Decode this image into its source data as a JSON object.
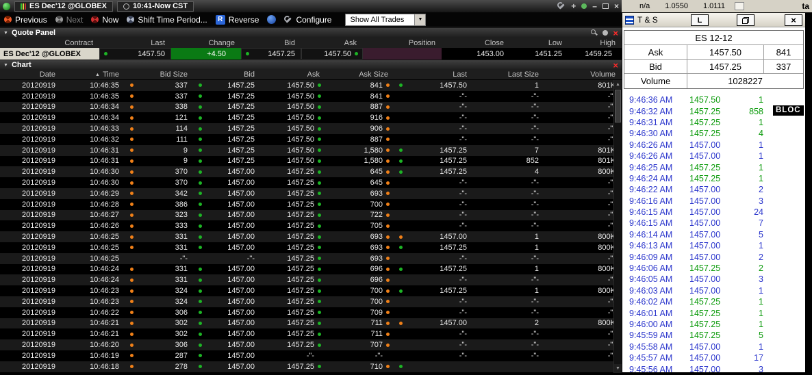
{
  "icons": {
    "close": "×",
    "minimize": "–",
    "collapse": "▼",
    "sort_asc": "▲",
    "up_arrow": "▲",
    "down_arrow": "▼",
    "dropdown_arrow": "▼"
  },
  "colors": {
    "dot_green": "#1db425",
    "dot_orange": "#f08018",
    "change_bg": "#0a7a14",
    "ask_green": "#0a9a0a",
    "bid_blue": "#2a35cc",
    "contract_bg": "#d9d6ca",
    "position_bg": "#3a1c2e"
  },
  "top_fragment": {
    "values": [
      "n/a",
      "1.0550",
      "1.0111"
    ],
    "tab_text": "ta"
  },
  "left_window": {
    "title": {
      "symbol": "ES Dec'12 @GLOBEX",
      "range": "10:41-Now CST"
    },
    "toolbar": {
      "previous": "Previous",
      "next": "Next",
      "now": "Now",
      "shift_time": "Shift Time Period...",
      "reverse_letter": "R",
      "reverse": "Reverse",
      "configure": "Configure",
      "trades_filter": "Show All Trades"
    },
    "quote_panel": {
      "title": "Quote Panel",
      "columns": [
        "Contract",
        "Last",
        "Change",
        "Bid",
        "Ask",
        "Position",
        "Close",
        "Low",
        "High"
      ],
      "row": {
        "contract": "ES Dec'12 @GLOBEX",
        "last": "1457.50",
        "change": "+4.50",
        "bid": "1457.25",
        "ask": "1457.50",
        "position": "",
        "close": "1453.00",
        "low": "1451.25",
        "high": "1459.25"
      }
    },
    "chart": {
      "title": "Chart",
      "columns": [
        "Date",
        "Time",
        "Bid Size",
        "Bid",
        "Ask",
        "Ask Size",
        "Last",
        "Last Size",
        "Volume"
      ],
      "rows": [
        {
          "date": "20120919",
          "time": "10:46:35",
          "bid_size": "337",
          "bs_dot": "orange",
          "bid": "1457.25",
          "bid_dot": "green",
          "ask": "1457.50",
          "ask_dot": "green",
          "ask_size": "841",
          "as_dot": "orange",
          "last": "1457.50",
          "last_dot": "green",
          "last_size": "1",
          "volume": "801K"
        },
        {
          "date": "20120919",
          "time": "10:46:35",
          "bid_size": "337",
          "bs_dot": "orange",
          "bid": "1457.25",
          "bid_dot": "green",
          "ask": "1457.50",
          "ask_dot": "green",
          "ask_size": "841",
          "as_dot": "orange",
          "last": "-\"-",
          "last_size": "-\"-",
          "volume": "-\"-"
        },
        {
          "date": "20120919",
          "time": "10:46:34",
          "bid_size": "338",
          "bs_dot": "orange",
          "bid": "1457.25",
          "bid_dot": "green",
          "ask": "1457.50",
          "ask_dot": "green",
          "ask_size": "887",
          "as_dot": "orange",
          "last": "-\"-",
          "last_size": "-\"-",
          "volume": "-\"-"
        },
        {
          "date": "20120919",
          "time": "10:46:34",
          "bid_size": "121",
          "bs_dot": "orange",
          "bid": "1457.25",
          "bid_dot": "green",
          "ask": "1457.50",
          "ask_dot": "green",
          "ask_size": "916",
          "as_dot": "orange",
          "last": "-\"-",
          "last_size": "-\"-",
          "volume": "-\"-"
        },
        {
          "date": "20120919",
          "time": "10:46:33",
          "bid_size": "114",
          "bs_dot": "orange",
          "bid": "1457.25",
          "bid_dot": "green",
          "ask": "1457.50",
          "ask_dot": "green",
          "ask_size": "906",
          "as_dot": "orange",
          "last": "-\"-",
          "last_size": "-\"-",
          "volume": "-\"-"
        },
        {
          "date": "20120919",
          "time": "10:46:32",
          "bid_size": "111",
          "bs_dot": "orange",
          "bid": "1457.25",
          "bid_dot": "green",
          "ask": "1457.50",
          "ask_dot": "green",
          "ask_size": "887",
          "as_dot": "orange",
          "last": "-\"-",
          "last_size": "-\"-",
          "volume": "-\"-"
        },
        {
          "date": "20120919",
          "time": "10:46:31",
          "bid_size": "9",
          "bs_dot": "orange",
          "bid": "1457.25",
          "bid_dot": "green",
          "ask": "1457.50",
          "ask_dot": "green",
          "ask_size": "1,580",
          "as_dot": "orange",
          "last": "1457.25",
          "last_dot": "green",
          "last_size": "7",
          "volume": "801K"
        },
        {
          "date": "20120919",
          "time": "10:46:31",
          "bid_size": "9",
          "bs_dot": "orange",
          "bid": "1457.25",
          "bid_dot": "green",
          "ask": "1457.50",
          "ask_dot": "green",
          "ask_size": "1,580",
          "as_dot": "orange",
          "last": "1457.25",
          "last_dot": "green",
          "last_size": "852",
          "volume": "801K"
        },
        {
          "date": "20120919",
          "time": "10:46:30",
          "bid_size": "370",
          "bs_dot": "orange",
          "bid": "1457.00",
          "bid_dot": "green",
          "ask": "1457.25",
          "ask_dot": "green",
          "ask_size": "645",
          "as_dot": "orange",
          "last": "1457.25",
          "last_dot": "green",
          "last_size": "4",
          "volume": "800K"
        },
        {
          "date": "20120919",
          "time": "10:46:30",
          "bid_size": "370",
          "bs_dot": "orange",
          "bid": "1457.00",
          "bid_dot": "green",
          "ask": "1457.25",
          "ask_dot": "green",
          "ask_size": "645",
          "as_dot": "orange",
          "last": "-\"-",
          "last_size": "-\"-",
          "volume": "-\"-"
        },
        {
          "date": "20120919",
          "time": "10:46:29",
          "bid_size": "342",
          "bs_dot": "orange",
          "bid": "1457.00",
          "bid_dot": "green",
          "ask": "1457.25",
          "ask_dot": "green",
          "ask_size": "693",
          "as_dot": "orange",
          "last": "-\"-",
          "last_size": "-\"-",
          "volume": "-\"-"
        },
        {
          "date": "20120919",
          "time": "10:46:28",
          "bid_size": "386",
          "bs_dot": "orange",
          "bid": "1457.00",
          "bid_dot": "green",
          "ask": "1457.25",
          "ask_dot": "green",
          "ask_size": "700",
          "as_dot": "orange",
          "last": "-\"-",
          "last_size": "-\"-",
          "volume": "-\"-"
        },
        {
          "date": "20120919",
          "time": "10:46:27",
          "bid_size": "323",
          "bs_dot": "orange",
          "bid": "1457.00",
          "bid_dot": "green",
          "ask": "1457.25",
          "ask_dot": "green",
          "ask_size": "722",
          "as_dot": "orange",
          "last": "-\"-",
          "last_size": "-\"-",
          "volume": "-\"-"
        },
        {
          "date": "20120919",
          "time": "10:46:26",
          "bid_size": "333",
          "bs_dot": "orange",
          "bid": "1457.00",
          "bid_dot": "green",
          "ask": "1457.25",
          "ask_dot": "green",
          "ask_size": "705",
          "as_dot": "orange",
          "last": "-\"-",
          "last_size": "-\"-",
          "volume": "-\"-"
        },
        {
          "date": "20120919",
          "time": "10:46:25",
          "bid_size": "331",
          "bs_dot": "orange",
          "bid": "1457.00",
          "bid_dot": "green",
          "ask": "1457.25",
          "ask_dot": "green",
          "ask_size": "693",
          "as_dot": "orange",
          "last": "1457.00",
          "last_dot": "orange",
          "last_size": "1",
          "volume": "800K"
        },
        {
          "date": "20120919",
          "time": "10:46:25",
          "bid_size": "331",
          "bs_dot": "orange",
          "bid": "1457.00",
          "bid_dot": "green",
          "ask": "1457.25",
          "ask_dot": "green",
          "ask_size": "693",
          "as_dot": "orange",
          "last": "1457.25",
          "last_dot": "green",
          "last_size": "1",
          "volume": "800K"
        },
        {
          "date": "20120919",
          "time": "10:46:25",
          "bid_size": "-\"-",
          "bid": "-\"-",
          "ask": "1457.25",
          "ask_dot": "green",
          "ask_size": "693",
          "as_dot": "orange",
          "last": "-\"-",
          "last_size": "-\"-",
          "volume": "-\"-"
        },
        {
          "date": "20120919",
          "time": "10:46:24",
          "bid_size": "331",
          "bs_dot": "orange",
          "bid": "1457.00",
          "bid_dot": "green",
          "ask": "1457.25",
          "ask_dot": "green",
          "ask_size": "696",
          "as_dot": "orange",
          "last": "1457.25",
          "last_dot": "green",
          "last_size": "1",
          "volume": "800K"
        },
        {
          "date": "20120919",
          "time": "10:46:24",
          "bid_size": "331",
          "bs_dot": "orange",
          "bid": "1457.00",
          "bid_dot": "green",
          "ask": "1457.25",
          "ask_dot": "green",
          "ask_size": "696",
          "as_dot": "orange",
          "last": "-\"-",
          "last_size": "-\"-",
          "volume": "-\"-"
        },
        {
          "date": "20120919",
          "time": "10:46:23",
          "bid_size": "324",
          "bs_dot": "orange",
          "bid": "1457.00",
          "bid_dot": "green",
          "ask": "1457.25",
          "ask_dot": "green",
          "ask_size": "700",
          "as_dot": "orange",
          "last": "1457.25",
          "last_dot": "green",
          "last_size": "1",
          "volume": "800K"
        },
        {
          "date": "20120919",
          "time": "10:46:23",
          "bid_size": "324",
          "bs_dot": "orange",
          "bid": "1457.00",
          "bid_dot": "green",
          "ask": "1457.25",
          "ask_dot": "green",
          "ask_size": "700",
          "as_dot": "orange",
          "last": "-\"-",
          "last_size": "-\"-",
          "volume": "-\"-"
        },
        {
          "date": "20120919",
          "time": "10:46:22",
          "bid_size": "306",
          "bs_dot": "orange",
          "bid": "1457.00",
          "bid_dot": "green",
          "ask": "1457.25",
          "ask_dot": "green",
          "ask_size": "709",
          "as_dot": "orange",
          "last": "-\"-",
          "last_size": "-\"-",
          "volume": "-\"-"
        },
        {
          "date": "20120919",
          "time": "10:46:21",
          "bid_size": "302",
          "bs_dot": "orange",
          "bid": "1457.00",
          "bid_dot": "green",
          "ask": "1457.25",
          "ask_dot": "green",
          "ask_size": "711",
          "as_dot": "orange",
          "last": "1457.00",
          "last_dot": "orange",
          "last_size": "2",
          "volume": "800K"
        },
        {
          "date": "20120919",
          "time": "10:46:21",
          "bid_size": "302",
          "bs_dot": "orange",
          "bid": "1457.00",
          "bid_dot": "green",
          "ask": "1457.25",
          "ask_dot": "green",
          "ask_size": "711",
          "as_dot": "orange",
          "last": "-\"-",
          "last_size": "-\"-",
          "volume": "-\"-"
        },
        {
          "date": "20120919",
          "time": "10:46:20",
          "bid_size": "306",
          "bs_dot": "orange",
          "bid": "1457.00",
          "bid_dot": "green",
          "ask": "1457.25",
          "ask_dot": "green",
          "ask_size": "707",
          "as_dot": "orange",
          "last": "-\"-",
          "last_size": "-\"-",
          "volume": "-\"-"
        },
        {
          "date": "20120919",
          "time": "10:46:19",
          "bid_size": "287",
          "bs_dot": "orange",
          "bid": "1457.00",
          "bid_dot": "green",
          "ask": "-\"-",
          "ask_size": "-\"-",
          "last": "-\"-",
          "last_size": "-\"-",
          "volume": "-\"-"
        },
        {
          "date": "20120919",
          "time": "10:46:18",
          "bid_size": "278",
          "bs_dot": "orange",
          "bid": "1457.00",
          "bid_dot": "green",
          "ask": "1457.25",
          "ask_dot": "green",
          "ask_size": "710",
          "as_dot": "orange",
          "last": "",
          "last_dot": "green",
          "last_size": "",
          "volume": ""
        }
      ]
    }
  },
  "ts_window": {
    "title": "T & S",
    "l_button": "L",
    "symbol": "ES 12-12",
    "quote": {
      "ask_label": "Ask",
      "ask_price": "1457.50",
      "ask_size": "841",
      "bid_label": "Bid",
      "bid_price": "1457.25",
      "bid_size": "337",
      "volume_label": "Volume",
      "volume_value": "1028227"
    },
    "trades": [
      {
        "time": "9:46:36 AM",
        "price": "1457.50",
        "size": "1",
        "side": "ask"
      },
      {
        "time": "9:46:32 AM",
        "price": "1457.25",
        "size": "858",
        "side": "ask",
        "block": "BLOC"
      },
      {
        "time": "9:46:31 AM",
        "price": "1457.25",
        "size": "1",
        "side": "ask"
      },
      {
        "time": "9:46:30 AM",
        "price": "1457.25",
        "size": "4",
        "side": "ask"
      },
      {
        "time": "9:46:26 AM",
        "price": "1457.00",
        "size": "1",
        "side": "bid"
      },
      {
        "time": "9:46:26 AM",
        "price": "1457.00",
        "size": "1",
        "side": "bid"
      },
      {
        "time": "9:46:25 AM",
        "price": "1457.25",
        "size": "1",
        "side": "ask"
      },
      {
        "time": "9:46:24 AM",
        "price": "1457.25",
        "size": "1",
        "side": "ask"
      },
      {
        "time": "9:46:22 AM",
        "price": "1457.00",
        "size": "2",
        "side": "bid"
      },
      {
        "time": "9:46:16 AM",
        "price": "1457.00",
        "size": "3",
        "side": "bid"
      },
      {
        "time": "9:46:15 AM",
        "price": "1457.00",
        "size": "24",
        "side": "bid"
      },
      {
        "time": "9:46:15 AM",
        "price": "1457.00",
        "size": "7",
        "side": "bid"
      },
      {
        "time": "9:46:14 AM",
        "price": "1457.00",
        "size": "5",
        "side": "bid"
      },
      {
        "time": "9:46:13 AM",
        "price": "1457.00",
        "size": "1",
        "side": "bid"
      },
      {
        "time": "9:46:09 AM",
        "price": "1457.00",
        "size": "2",
        "side": "bid"
      },
      {
        "time": "9:46:06 AM",
        "price": "1457.25",
        "size": "2",
        "side": "ask"
      },
      {
        "time": "9:46:05 AM",
        "price": "1457.00",
        "size": "3",
        "side": "bid"
      },
      {
        "time": "9:46:03 AM",
        "price": "1457.00",
        "size": "1",
        "side": "bid"
      },
      {
        "time": "9:46:02 AM",
        "price": "1457.25",
        "size": "1",
        "side": "ask"
      },
      {
        "time": "9:46:01 AM",
        "price": "1457.25",
        "size": "1",
        "side": "ask"
      },
      {
        "time": "9:46:00 AM",
        "price": "1457.25",
        "size": "1",
        "side": "ask"
      },
      {
        "time": "9:45:59 AM",
        "price": "1457.25",
        "size": "5",
        "side": "ask"
      },
      {
        "time": "9:45:58 AM",
        "price": "1457.00",
        "size": "1",
        "side": "bid"
      },
      {
        "time": "9:45:57 AM",
        "price": "1457.00",
        "size": "17",
        "side": "bid"
      },
      {
        "time": "9:45:56 AM",
        "price": "1457.00",
        "size": "3",
        "side": "bid"
      }
    ]
  }
}
